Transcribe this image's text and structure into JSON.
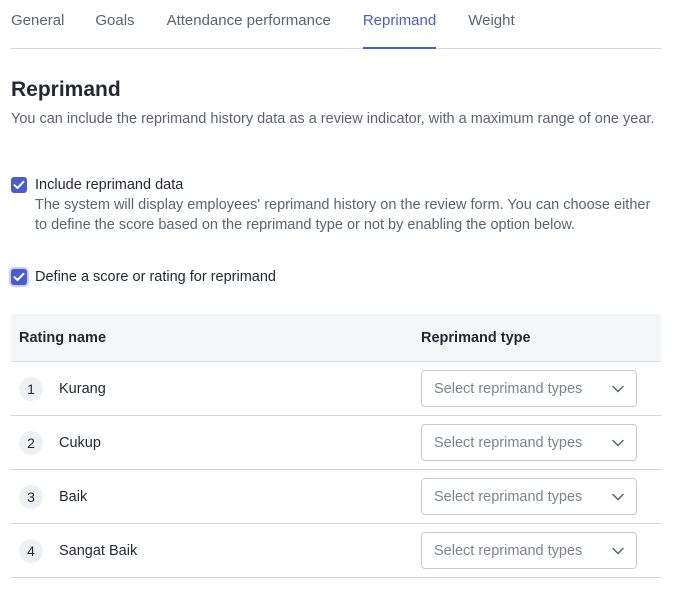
{
  "tabs": [
    "General",
    "Goals",
    "Attendance performance",
    "Reprimand",
    "Weight"
  ],
  "active_tab": "Reprimand",
  "section": {
    "title": "Reprimand",
    "description": "You can include the reprimand history data as a review indicator, with a maximum range of one year."
  },
  "include_option": {
    "checked": true,
    "label": "Include reprimand data",
    "description": "The system will display employees' reprimand history on the review form. You can choose either to define the score based on the reprimand type or not by enabling the option below."
  },
  "score_option": {
    "checked": true,
    "label": "Define a score or rating for reprimand"
  },
  "table": {
    "headers": {
      "name": "Rating name",
      "type": "Reprimand type"
    },
    "rows": [
      {
        "num": "1",
        "name": "Kurang",
        "placeholder": "Select reprimand types"
      },
      {
        "num": "2",
        "name": "Cukup",
        "placeholder": "Select reprimand types"
      },
      {
        "num": "3",
        "name": "Baik",
        "placeholder": "Select reprimand types"
      },
      {
        "num": "4",
        "name": "Sangat Baik",
        "placeholder": "Select reprimand types"
      }
    ]
  },
  "colors": {
    "accent": "#4a5ccf",
    "text": "#232933",
    "muted": "#5b6370",
    "border": "#d6d9de"
  }
}
